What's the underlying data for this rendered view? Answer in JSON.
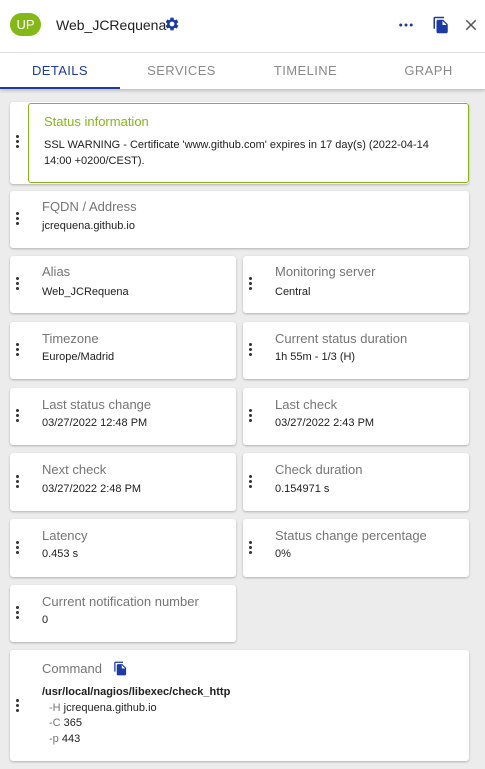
{
  "header": {
    "badge": "UP",
    "host_name": "Web_JCRequena",
    "icons": [
      "gear-icon",
      "more-vert-icon",
      "copy-icon",
      "close-icon"
    ],
    "badge_color": "#84b817",
    "accent_color": "#1c3aa5"
  },
  "tabs": [
    {
      "label": "DETAILS",
      "active": true
    },
    {
      "label": "SERVICES",
      "active": false
    },
    {
      "label": "TIMELINE",
      "active": false
    },
    {
      "label": "GRAPH",
      "active": false
    }
  ],
  "status": {
    "title": "Status information",
    "text": "SSL WARNING - Certificate 'www.github.com' expires in 17 day(s) (2022-04-14 14:00 +0200/CEST)."
  },
  "details": {
    "fqdn": {
      "title": "FQDN / Address",
      "value": "jcrequena.github.io"
    },
    "alias": {
      "title": "Alias",
      "value": "Web_JCRequena"
    },
    "monitoring_server": {
      "title": "Monitoring server",
      "value": "Central"
    },
    "timezone": {
      "title": "Timezone",
      "value": "Europe/Madrid"
    },
    "current_status_duration": {
      "title": "Current status duration",
      "value": "1h 55m - 1/3 (H)"
    },
    "last_status_change": {
      "title": "Last status change",
      "value": "03/27/2022 12:48 PM"
    },
    "last_check": {
      "title": "Last check",
      "value": "03/27/2022 2:43 PM"
    },
    "next_check": {
      "title": "Next check",
      "value": "03/27/2022 2:48 PM"
    },
    "check_duration": {
      "title": "Check duration",
      "value": "0.154971 s"
    },
    "latency": {
      "title": "Latency",
      "value": "0.453 s"
    },
    "status_change_percentage": {
      "title": "Status change percentage",
      "value": "0%"
    },
    "current_notification_number": {
      "title": "Current notification number",
      "value": "0"
    }
  },
  "command": {
    "title": "Command",
    "path": "/usr/local/nagios/libexec/check_http",
    "args": [
      {
        "flag": "-H",
        "value": "jcrequena.github.io"
      },
      {
        "flag": "-C",
        "value": "365"
      },
      {
        "flag": "-p",
        "value": "443"
      }
    ]
  }
}
